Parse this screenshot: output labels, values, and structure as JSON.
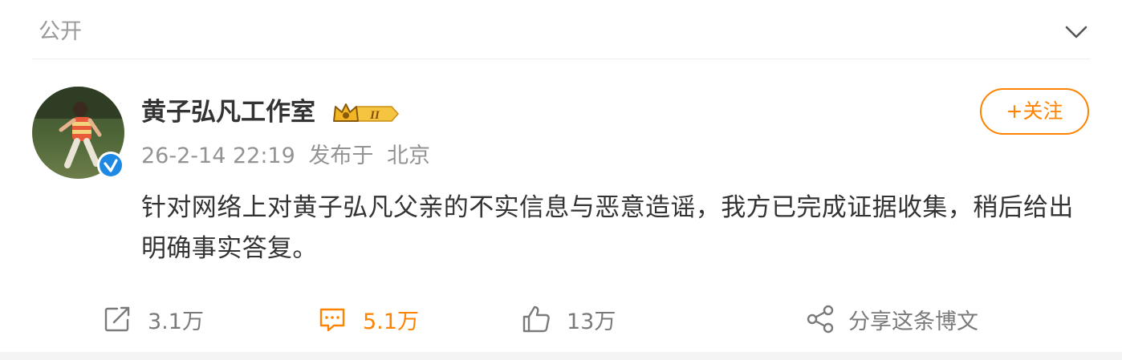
{
  "visibility": {
    "label": "公开",
    "icon": "chevron-down-icon"
  },
  "post": {
    "author": "黄子弘凡工作室",
    "verified_icon": "verified-badge-icon",
    "vip_badge_icon": "crown-vip-level-II-icon",
    "vip_badge_text": "II",
    "time": "26-2-14 22:19",
    "published_at": "发布于",
    "location": "北京",
    "follow_label": "+关注",
    "text": "针对网络上对黄子弘凡父亲的不实信息与恶意造谣，我方已完成证据收集，稍后给出明确事实答复。"
  },
  "actions": {
    "repost": {
      "icon": "repost-icon",
      "count": "3.1万"
    },
    "comment": {
      "icon": "comment-icon",
      "count": "5.1万"
    },
    "like": {
      "icon": "thumbs-up-icon",
      "count": "13万"
    },
    "share": {
      "icon": "share-icon",
      "label": "分享这条博文"
    }
  },
  "colors": {
    "accent": "#ff8200",
    "muted": "#939393",
    "verified": "#1e88e5",
    "text": "#333333"
  }
}
